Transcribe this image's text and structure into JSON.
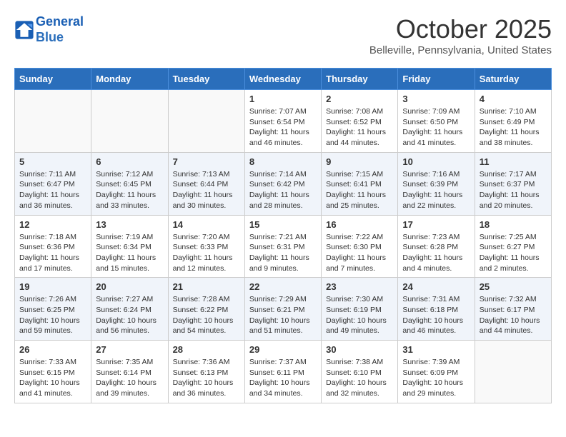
{
  "header": {
    "logo_line1": "General",
    "logo_line2": "Blue",
    "month": "October 2025",
    "location": "Belleville, Pennsylvania, United States"
  },
  "days_of_week": [
    "Sunday",
    "Monday",
    "Tuesday",
    "Wednesday",
    "Thursday",
    "Friday",
    "Saturday"
  ],
  "weeks": [
    [
      {
        "day": "",
        "info": ""
      },
      {
        "day": "",
        "info": ""
      },
      {
        "day": "",
        "info": ""
      },
      {
        "day": "1",
        "info": "Sunrise: 7:07 AM\nSunset: 6:54 PM\nDaylight: 11 hours and 46 minutes."
      },
      {
        "day": "2",
        "info": "Sunrise: 7:08 AM\nSunset: 6:52 PM\nDaylight: 11 hours and 44 minutes."
      },
      {
        "day": "3",
        "info": "Sunrise: 7:09 AM\nSunset: 6:50 PM\nDaylight: 11 hours and 41 minutes."
      },
      {
        "day": "4",
        "info": "Sunrise: 7:10 AM\nSunset: 6:49 PM\nDaylight: 11 hours and 38 minutes."
      }
    ],
    [
      {
        "day": "5",
        "info": "Sunrise: 7:11 AM\nSunset: 6:47 PM\nDaylight: 11 hours and 36 minutes."
      },
      {
        "day": "6",
        "info": "Sunrise: 7:12 AM\nSunset: 6:45 PM\nDaylight: 11 hours and 33 minutes."
      },
      {
        "day": "7",
        "info": "Sunrise: 7:13 AM\nSunset: 6:44 PM\nDaylight: 11 hours and 30 minutes."
      },
      {
        "day": "8",
        "info": "Sunrise: 7:14 AM\nSunset: 6:42 PM\nDaylight: 11 hours and 28 minutes."
      },
      {
        "day": "9",
        "info": "Sunrise: 7:15 AM\nSunset: 6:41 PM\nDaylight: 11 hours and 25 minutes."
      },
      {
        "day": "10",
        "info": "Sunrise: 7:16 AM\nSunset: 6:39 PM\nDaylight: 11 hours and 22 minutes."
      },
      {
        "day": "11",
        "info": "Sunrise: 7:17 AM\nSunset: 6:37 PM\nDaylight: 11 hours and 20 minutes."
      }
    ],
    [
      {
        "day": "12",
        "info": "Sunrise: 7:18 AM\nSunset: 6:36 PM\nDaylight: 11 hours and 17 minutes."
      },
      {
        "day": "13",
        "info": "Sunrise: 7:19 AM\nSunset: 6:34 PM\nDaylight: 11 hours and 15 minutes."
      },
      {
        "day": "14",
        "info": "Sunrise: 7:20 AM\nSunset: 6:33 PM\nDaylight: 11 hours and 12 minutes."
      },
      {
        "day": "15",
        "info": "Sunrise: 7:21 AM\nSunset: 6:31 PM\nDaylight: 11 hours and 9 minutes."
      },
      {
        "day": "16",
        "info": "Sunrise: 7:22 AM\nSunset: 6:30 PM\nDaylight: 11 hours and 7 minutes."
      },
      {
        "day": "17",
        "info": "Sunrise: 7:23 AM\nSunset: 6:28 PM\nDaylight: 11 hours and 4 minutes."
      },
      {
        "day": "18",
        "info": "Sunrise: 7:25 AM\nSunset: 6:27 PM\nDaylight: 11 hours and 2 minutes."
      }
    ],
    [
      {
        "day": "19",
        "info": "Sunrise: 7:26 AM\nSunset: 6:25 PM\nDaylight: 10 hours and 59 minutes."
      },
      {
        "day": "20",
        "info": "Sunrise: 7:27 AM\nSunset: 6:24 PM\nDaylight: 10 hours and 56 minutes."
      },
      {
        "day": "21",
        "info": "Sunrise: 7:28 AM\nSunset: 6:22 PM\nDaylight: 10 hours and 54 minutes."
      },
      {
        "day": "22",
        "info": "Sunrise: 7:29 AM\nSunset: 6:21 PM\nDaylight: 10 hours and 51 minutes."
      },
      {
        "day": "23",
        "info": "Sunrise: 7:30 AM\nSunset: 6:19 PM\nDaylight: 10 hours and 49 minutes."
      },
      {
        "day": "24",
        "info": "Sunrise: 7:31 AM\nSunset: 6:18 PM\nDaylight: 10 hours and 46 minutes."
      },
      {
        "day": "25",
        "info": "Sunrise: 7:32 AM\nSunset: 6:17 PM\nDaylight: 10 hours and 44 minutes."
      }
    ],
    [
      {
        "day": "26",
        "info": "Sunrise: 7:33 AM\nSunset: 6:15 PM\nDaylight: 10 hours and 41 minutes."
      },
      {
        "day": "27",
        "info": "Sunrise: 7:35 AM\nSunset: 6:14 PM\nDaylight: 10 hours and 39 minutes."
      },
      {
        "day": "28",
        "info": "Sunrise: 7:36 AM\nSunset: 6:13 PM\nDaylight: 10 hours and 36 minutes."
      },
      {
        "day": "29",
        "info": "Sunrise: 7:37 AM\nSunset: 6:11 PM\nDaylight: 10 hours and 34 minutes."
      },
      {
        "day": "30",
        "info": "Sunrise: 7:38 AM\nSunset: 6:10 PM\nDaylight: 10 hours and 32 minutes."
      },
      {
        "day": "31",
        "info": "Sunrise: 7:39 AM\nSunset: 6:09 PM\nDaylight: 10 hours and 29 minutes."
      },
      {
        "day": "",
        "info": ""
      }
    ]
  ]
}
